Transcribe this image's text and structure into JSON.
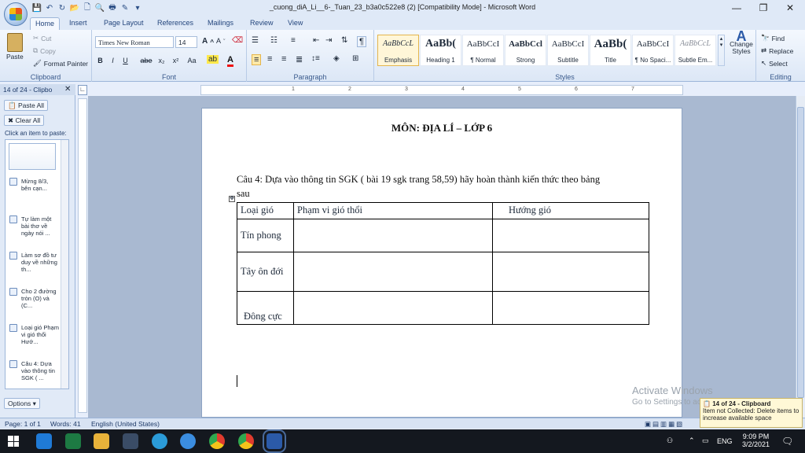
{
  "window": {
    "title": "_cuong_diA_Li__6-_Tuan_23_b3a0c522e8 (2) [Compatibility Mode] - Microsoft Word",
    "minimize": "—",
    "maximize": "❐",
    "close": "✕"
  },
  "tabs": [
    "Home",
    "Insert",
    "Page Layout",
    "References",
    "Mailings",
    "Review",
    "View"
  ],
  "ribbon": {
    "clipboard": {
      "label": "Clipboard",
      "paste": "Paste",
      "cut": "Cut",
      "copy": "Copy",
      "format_painter": "Format Painter"
    },
    "font": {
      "label": "Font",
      "family": "Times New Roman",
      "size": "14",
      "bold": "B",
      "italic": "I",
      "underline": "U",
      "strike": "abe",
      "sub": "x₂",
      "sup": "x²",
      "case": "Aa"
    },
    "paragraph": {
      "label": "Paragraph"
    },
    "styles": {
      "label": "Styles",
      "items": [
        {
          "sample": "AaBbCcL",
          "name": "Emphasis"
        },
        {
          "sample": "AaBb(",
          "name": "Heading 1"
        },
        {
          "sample": "AaBbCcI",
          "name": "¶ Normal"
        },
        {
          "sample": "AaBbCcl",
          "name": "Strong"
        },
        {
          "sample": "AaBbCcI",
          "name": "Subtitle"
        },
        {
          "sample": "AaBb(",
          "name": "Title"
        },
        {
          "sample": "AaBbCcI",
          "name": "¶ No Spaci..."
        },
        {
          "sample": "AaBbCcL",
          "name": "Subtle Em..."
        }
      ],
      "change_styles": "Change Styles"
    },
    "editing": {
      "label": "Editing",
      "find": "Find",
      "replace": "Replace",
      "select": "Select"
    }
  },
  "ruler": {
    "ticks": [
      "1",
      "2",
      "3",
      "4",
      "5",
      "6",
      "7"
    ]
  },
  "clipboard_pane": {
    "header": "14 of 24 - Clipbo",
    "paste_all": "Paste All",
    "clear_all": "Clear All",
    "hint": "Click an item to paste:",
    "items": [
      "Mừng 8/3, bên cạn...",
      "Tự làm một bài thơ về ngày nói ...",
      "Làm sơ đồ tư duy về những th...",
      "Cho 2 đường tròn (O) và (C...",
      "Loại gió Phạm vi gió thổi Hướ...",
      "Câu 4: Dựa vào thông tin SGK ( ..."
    ],
    "options": "Options"
  },
  "document": {
    "heading": "MÔN: ĐỊA LÍ – LỚP 6",
    "question_line1": "Câu 4:  Dựa vào thông tin SGK ( bài 19 sgk trang 58,59) hãy hoàn thành kiến thức theo bảng",
    "question_line2": "sau",
    "table": {
      "headers": [
        "Loại gió",
        "Phạm vi gió thổi",
        "Hướng gió"
      ],
      "rows": [
        "Tín phong",
        "Tây ôn đới",
        "Đông cực"
      ]
    }
  },
  "status": {
    "page": "Page: 1 of 1",
    "words": "Words: 41",
    "language": "English (United States)"
  },
  "watermark": {
    "title": "Activate Windows",
    "subtitle": "Go to Settings to activate Windows."
  },
  "toast": {
    "title": "14 of 24 - Clipboard",
    "body": "Item not Collected: Delete items to increase available space"
  },
  "taskbar": {
    "lang": "ENG",
    "time": "9:09 PM",
    "date": "3/2/2021"
  }
}
